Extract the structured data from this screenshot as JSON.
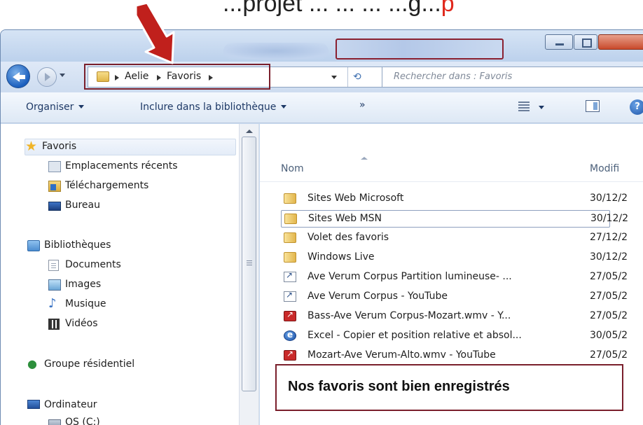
{
  "caption": {
    "text": "...projet ... ... ... ...g...",
    "accent_text": "p"
  },
  "window": {
    "blurred_title": "",
    "controls": [
      "minimize",
      "maximize",
      "close"
    ]
  },
  "address_bar": {
    "crumbs": [
      "Aelie",
      "Favoris"
    ],
    "search_placeholder": "Rechercher dans : Favoris"
  },
  "toolbar": {
    "organize_label": "Organiser",
    "include_label": "Inclure dans la bibliothèque",
    "more_label": "»",
    "help_label": "?"
  },
  "sidebar": {
    "favorites": {
      "label": "Favoris",
      "items": [
        "Emplacements récents",
        "Téléchargements",
        "Bureau"
      ]
    },
    "libraries": {
      "label": "Bibliothèques",
      "items": [
        "Documents",
        "Images",
        "Musique",
        "Vidéos"
      ]
    },
    "homegroup": {
      "label": "Groupe résidentiel"
    },
    "computer": {
      "label": "Ordinateur",
      "items": [
        "OS (C:)"
      ]
    }
  },
  "file_list": {
    "columns": {
      "name": "Nom",
      "modified": "Modifi"
    },
    "rows": [
      {
        "name": "Sites Web Microsoft",
        "date": "30/12/2",
        "type": "folder"
      },
      {
        "name": "Sites Web MSN",
        "date": "30/12/2",
        "type": "folder"
      },
      {
        "name": "Volet des favoris",
        "date": "27/12/2",
        "type": "folder"
      },
      {
        "name": "Windows Live",
        "date": "30/12/2",
        "type": "folder"
      },
      {
        "name": "Ave Verum Corpus  Partition lumineuse- ...",
        "date": "27/05/2",
        "type": "link"
      },
      {
        "name": "Ave Verum Corpus - YouTube",
        "date": "27/05/2",
        "type": "link"
      },
      {
        "name": "Bass-Ave Verum Corpus-Mozart.wmv - Y...",
        "date": "27/05/2",
        "type": "video"
      },
      {
        "name": "Excel - Copier et position relative et absol...",
        "date": "30/05/2",
        "type": "web"
      },
      {
        "name": "Mozart-Ave Verum-Alto.wmv - YouTube",
        "date": "27/05/2",
        "type": "video"
      }
    ]
  },
  "note": {
    "text": "Nos favoris sont bien enregistrés"
  },
  "colors": {
    "highlight_border": "#7a1f2b",
    "arrow_fill": "#c0201c",
    "accent_red": "#e0281c"
  }
}
